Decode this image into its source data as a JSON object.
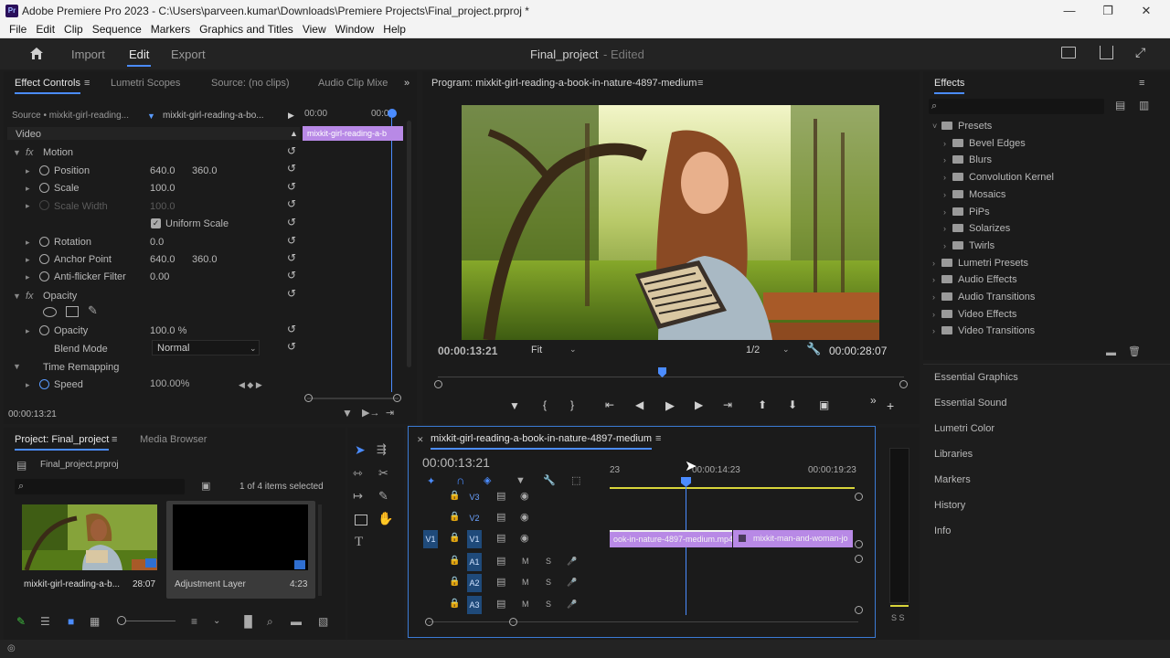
{
  "window": {
    "title": "Adobe Premiere Pro 2023 - C:\\Users\\parveen.kumar\\Downloads\\Premiere Projects\\Final_project.prproj *",
    "app_icon": "Pr"
  },
  "menu": [
    "File",
    "Edit",
    "Clip",
    "Sequence",
    "Markers",
    "Graphics and Titles",
    "View",
    "Window",
    "Help"
  ],
  "workspace": {
    "tabs": [
      "Import",
      "Edit",
      "Export"
    ],
    "project_name": "Final_project",
    "status": "- Edited"
  },
  "effect_controls": {
    "tabs": [
      "Effect Controls",
      "Lumetri Scopes",
      "Source: (no clips)",
      "Audio Clip Mixe"
    ],
    "source": "Source • mixkit-girl-reading...",
    "clip": "mixkit-girl-reading-a-bo...",
    "timecode_start": "00:00",
    "timecode_end": "00:00",
    "clip_bar_label": "mixkit-girl-reading-a-b",
    "section_video": "Video",
    "fx_label": "fx",
    "motion": "Motion",
    "position_label": "Position",
    "position_x": "640.0",
    "position_y": "360.0",
    "scale_label": "Scale",
    "scale_value": "100.0",
    "scale_width_label": "Scale Width",
    "scale_width_value": "100.0",
    "uniform_scale_label": "Uniform Scale",
    "rotation_label": "Rotation",
    "rotation_value": "0.0",
    "anchor_label": "Anchor Point",
    "anchor_x": "640.0",
    "anchor_y": "360.0",
    "antiflicker_label": "Anti-flicker Filter",
    "antiflicker_value": "0.00",
    "opacity_section": "Opacity",
    "opacity_label": "Opacity",
    "opacity_value": "100.0 %",
    "blend_label": "Blend Mode",
    "blend_value": "Normal",
    "time_remap": "Time Remapping",
    "speed_label": "Speed",
    "speed_value": "100.00%",
    "current_time": "00:00:13:21"
  },
  "program_monitor": {
    "title": "Program: mixkit-girl-reading-a-book-in-nature-4897-medium",
    "timecode": "00:00:13:21",
    "fit": "Fit",
    "resolution": "1/2",
    "duration": "00:00:28:07"
  },
  "effects_panel": {
    "title": "Effects",
    "tree": [
      {
        "label": "Presets",
        "level": 0,
        "open": true
      },
      {
        "label": "Bevel Edges",
        "level": 1
      },
      {
        "label": "Blurs",
        "level": 1
      },
      {
        "label": "Convolution Kernel",
        "level": 1
      },
      {
        "label": "Mosaics",
        "level": 1
      },
      {
        "label": "PiPs",
        "level": 1
      },
      {
        "label": "Solarizes",
        "level": 1
      },
      {
        "label": "Twirls",
        "level": 1
      },
      {
        "label": "Lumetri Presets",
        "level": 0
      },
      {
        "label": "Audio Effects",
        "level": 0
      },
      {
        "label": "Audio Transitions",
        "level": 0
      },
      {
        "label": "Video Effects",
        "level": 0
      },
      {
        "label": "Video Transitions",
        "level": 0
      }
    ],
    "side_panels": [
      "Essential Graphics",
      "Essential Sound",
      "Lumetri Color",
      "Libraries",
      "Markers",
      "History",
      "Info"
    ]
  },
  "project_panel": {
    "tabs": [
      "Project: Final_project",
      "Media Browser"
    ],
    "file": "Final_project.prproj",
    "items_selected": "1 of 4 items selected",
    "items": [
      {
        "name": "mixkit-girl-reading-a-b...",
        "duration": "28:07"
      },
      {
        "name": "Adjustment Layer",
        "duration": "4:23"
      }
    ]
  },
  "timeline": {
    "title": "mixkit-girl-reading-a-book-in-nature-4897-medium",
    "timecode": "00:00:13:21",
    "ruler": [
      "23",
      "00:00:14:23",
      "00:00:19:23"
    ],
    "tracks": [
      {
        "name": "V3",
        "type": "video"
      },
      {
        "name": "V2",
        "type": "video"
      },
      {
        "name": "V1",
        "type": "video",
        "source": "V1"
      },
      {
        "name": "A1",
        "type": "audio"
      },
      {
        "name": "A2",
        "type": "audio"
      },
      {
        "name": "A3",
        "type": "audio"
      }
    ],
    "mute_label": "M",
    "solo_label": "S",
    "clips": [
      {
        "label": "ook-in-nature-4897-medium.mp4",
        "track": "V1"
      },
      {
        "label": "mixkit-man-and-woman-jo",
        "track": "V1"
      }
    ],
    "meter_label": "S S"
  }
}
